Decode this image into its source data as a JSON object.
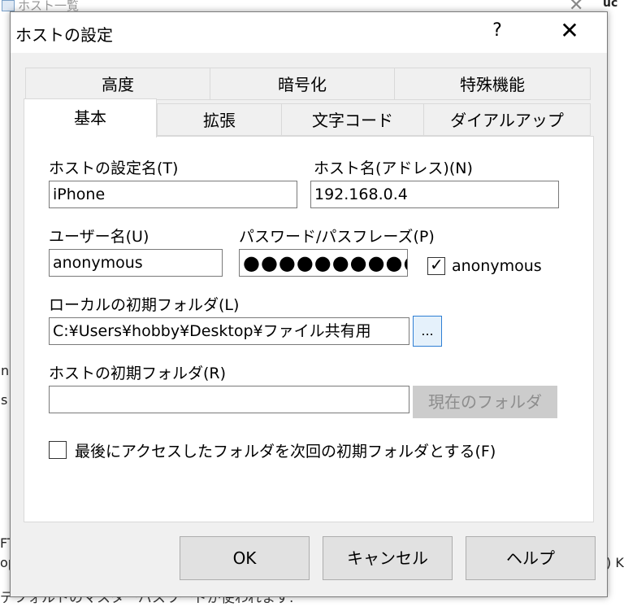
{
  "background": {
    "window_title": "ホスト一覧",
    "frag_right": "uc",
    "frag_left1": "n",
    "frag_left2": "s",
    "frag_left3": "FT",
    "frag_left4": "op",
    "frag_right2": ") K",
    "bottom_text": "デフォルトのマスターパスワードが使われます."
  },
  "dialog": {
    "title": "ホストの設定",
    "help_label": "?",
    "close_label": "✕"
  },
  "tabs": {
    "row1": [
      "高度",
      "暗号化",
      "特殊機能"
    ],
    "row2": [
      "基本",
      "拡張",
      "文字コード",
      "ダイアルアップ"
    ]
  },
  "form": {
    "host_setting_name": {
      "label": "ホストの設定名(T)",
      "value": "iPhone"
    },
    "host_name": {
      "label": "ホスト名(アドレス)(N)",
      "value": "192.168.0.4"
    },
    "user_name": {
      "label": "ユーザー名(U)",
      "value": "anonymous"
    },
    "password": {
      "label": "パスワード/パスフレーズ(P)",
      "value": "●●●●●●●●●●"
    },
    "anonymous": {
      "label": "anonymous",
      "checked": true
    },
    "local_folder": {
      "label": "ローカルの初期フォルダ(L)",
      "value": "C:¥Users¥hobby¥Desktop¥ファイル共有用",
      "browse_label": "..."
    },
    "host_folder": {
      "label": "ホストの初期フォルダ(R)",
      "value": "",
      "current_folder_button": "現在のフォルダ"
    },
    "last_folder": {
      "label": "最後にアクセスしたフォルダを次回の初期フォルダとする(F)",
      "checked": false
    }
  },
  "buttons": {
    "ok": "OK",
    "cancel": "キャンセル",
    "help": "ヘルプ"
  }
}
